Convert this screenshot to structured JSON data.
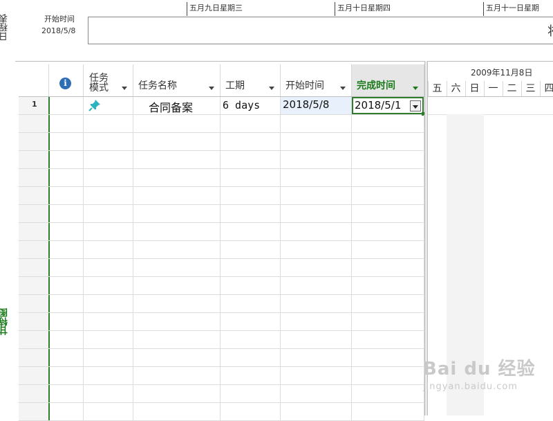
{
  "side": {
    "timeline_label": "日程表",
    "gantt_label": "甘特图"
  },
  "timeline": {
    "start_title": "开始时间",
    "start_date": "2018/5/8",
    "ticks": [
      "五月九日星期三",
      "五月十日星期四",
      "五月十一日星期"
    ],
    "bar_text": "将"
  },
  "grid": {
    "headers": {
      "info_icon": "i",
      "task_mode": "任务\n模式",
      "task_name": "任务名称",
      "duration": "工期",
      "start": "开始时间",
      "finish": "完成时间"
    },
    "rows": [
      {
        "id": "1",
        "mode_icon": "pin-icon",
        "name": "合同备案",
        "duration": "6 days",
        "start": "2018/5/8",
        "finish": "2018/5/1"
      }
    ]
  },
  "gantt": {
    "week_label": "2009年11月8日",
    "days": [
      "五",
      "六",
      "日",
      "一",
      "二",
      "三",
      "四"
    ]
  },
  "watermark": {
    "brand": "Bai du 经验",
    "url": "jingyan.baidu.com"
  },
  "colors": {
    "accent_green": "#2d7d2d",
    "info_blue": "#2f6eb5",
    "pin_teal": "#2bb3c0"
  }
}
